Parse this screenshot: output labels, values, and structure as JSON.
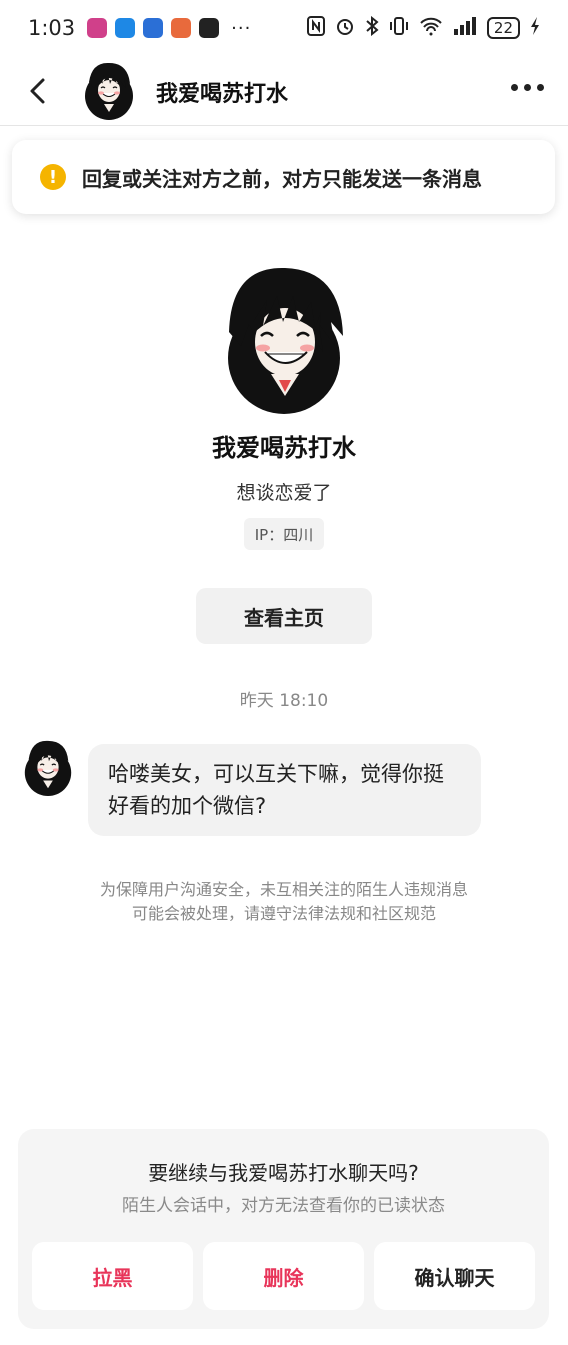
{
  "status_bar": {
    "time": "1:03",
    "more": "···",
    "battery": "22",
    "app_icon_colors": [
      "#d0408a",
      "#1e88e5",
      "#2b6fd6",
      "#e86a3c",
      "#222222"
    ],
    "right_icons": [
      "nfc-icon",
      "alarm-icon",
      "bluetooth-icon",
      "vibrate-icon",
      "wifi-icon",
      "signal-icon",
      "battery-icon",
      "charging-icon"
    ]
  },
  "nav": {
    "title": "我爱喝苏打水"
  },
  "notice": {
    "icon": "!",
    "text": "回复或关注对方之前，对方只能发送一条消息"
  },
  "profile": {
    "name": "我爱喝苏打水",
    "bio": "想谈恋爱了",
    "ip": "IP：四川",
    "home_button": "查看主页"
  },
  "conversation": {
    "timestamp": "昨天 18:10",
    "messages": [
      {
        "text": "哈喽美女，可以互关下嘛，觉得你挺好看的加个微信?"
      }
    ],
    "safety_notice": "为保障用户沟通安全，未互相关注的陌生人违规消息可能会被处理，请遵守法律法规和社区规范"
  },
  "stranger_card": {
    "title": "要继续与我爱喝苏打水聊天吗?",
    "subtitle": "陌生人会话中，对方无法查看你的已读状态",
    "block_label": "拉黑",
    "delete_label": "删除",
    "confirm_label": "确认聊天"
  },
  "colors": {
    "accent_red": "#e8355a",
    "warning": "#f5b400",
    "bubble_bg": "#f2f2f2",
    "card_bg": "#f5f5f5"
  }
}
